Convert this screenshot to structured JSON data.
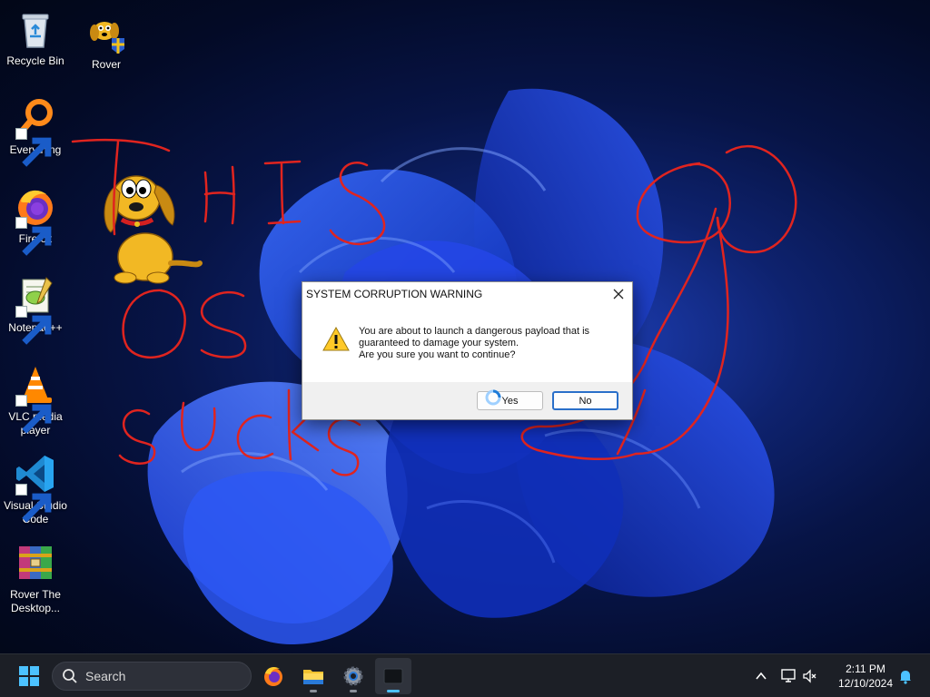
{
  "desktop": {
    "icons": [
      {
        "label": "Recycle Bin",
        "icon": "recycle-bin-icon",
        "shortcut": false
      },
      {
        "label": "Rover",
        "icon": "rover-dog-icon",
        "shortcut": false
      },
      {
        "label": "Everything",
        "icon": "everything-search-icon",
        "shortcut": true
      },
      {
        "label": "Firefox",
        "icon": "firefox-icon",
        "shortcut": true
      },
      {
        "label": "Notepad++",
        "icon": "notepad-plus-plus-icon",
        "shortcut": true
      },
      {
        "label": "VLC media player",
        "icon": "vlc-icon",
        "shortcut": true
      },
      {
        "label": "Visual Studio Code",
        "icon": "vscode-icon",
        "shortcut": true
      },
      {
        "label": "Rover The Desktop...",
        "icon": "winrar-archive-icon",
        "shortcut": false
      }
    ],
    "wallpaper": "windows-11-bloom",
    "scribble_color": "#e0241f"
  },
  "dialog": {
    "title": "SYSTEM CORRUPTION WARNING",
    "message_line1": "You are about to launch a dangerous payload that is",
    "message_line2": "guaranteed to damage your system.",
    "message_line3": "Are you sure you want to continue?",
    "yes_label": "Yes",
    "no_label": "No",
    "icon": "warning-icon"
  },
  "taskbar": {
    "search_label": "Search",
    "apps": [
      "start-icon",
      "firefox-icon",
      "file-explorer-icon",
      "settings-icon",
      "terminal-icon"
    ],
    "time": "2:11 PM",
    "date": "12/10/2024",
    "accent": "#4cc2ff"
  }
}
